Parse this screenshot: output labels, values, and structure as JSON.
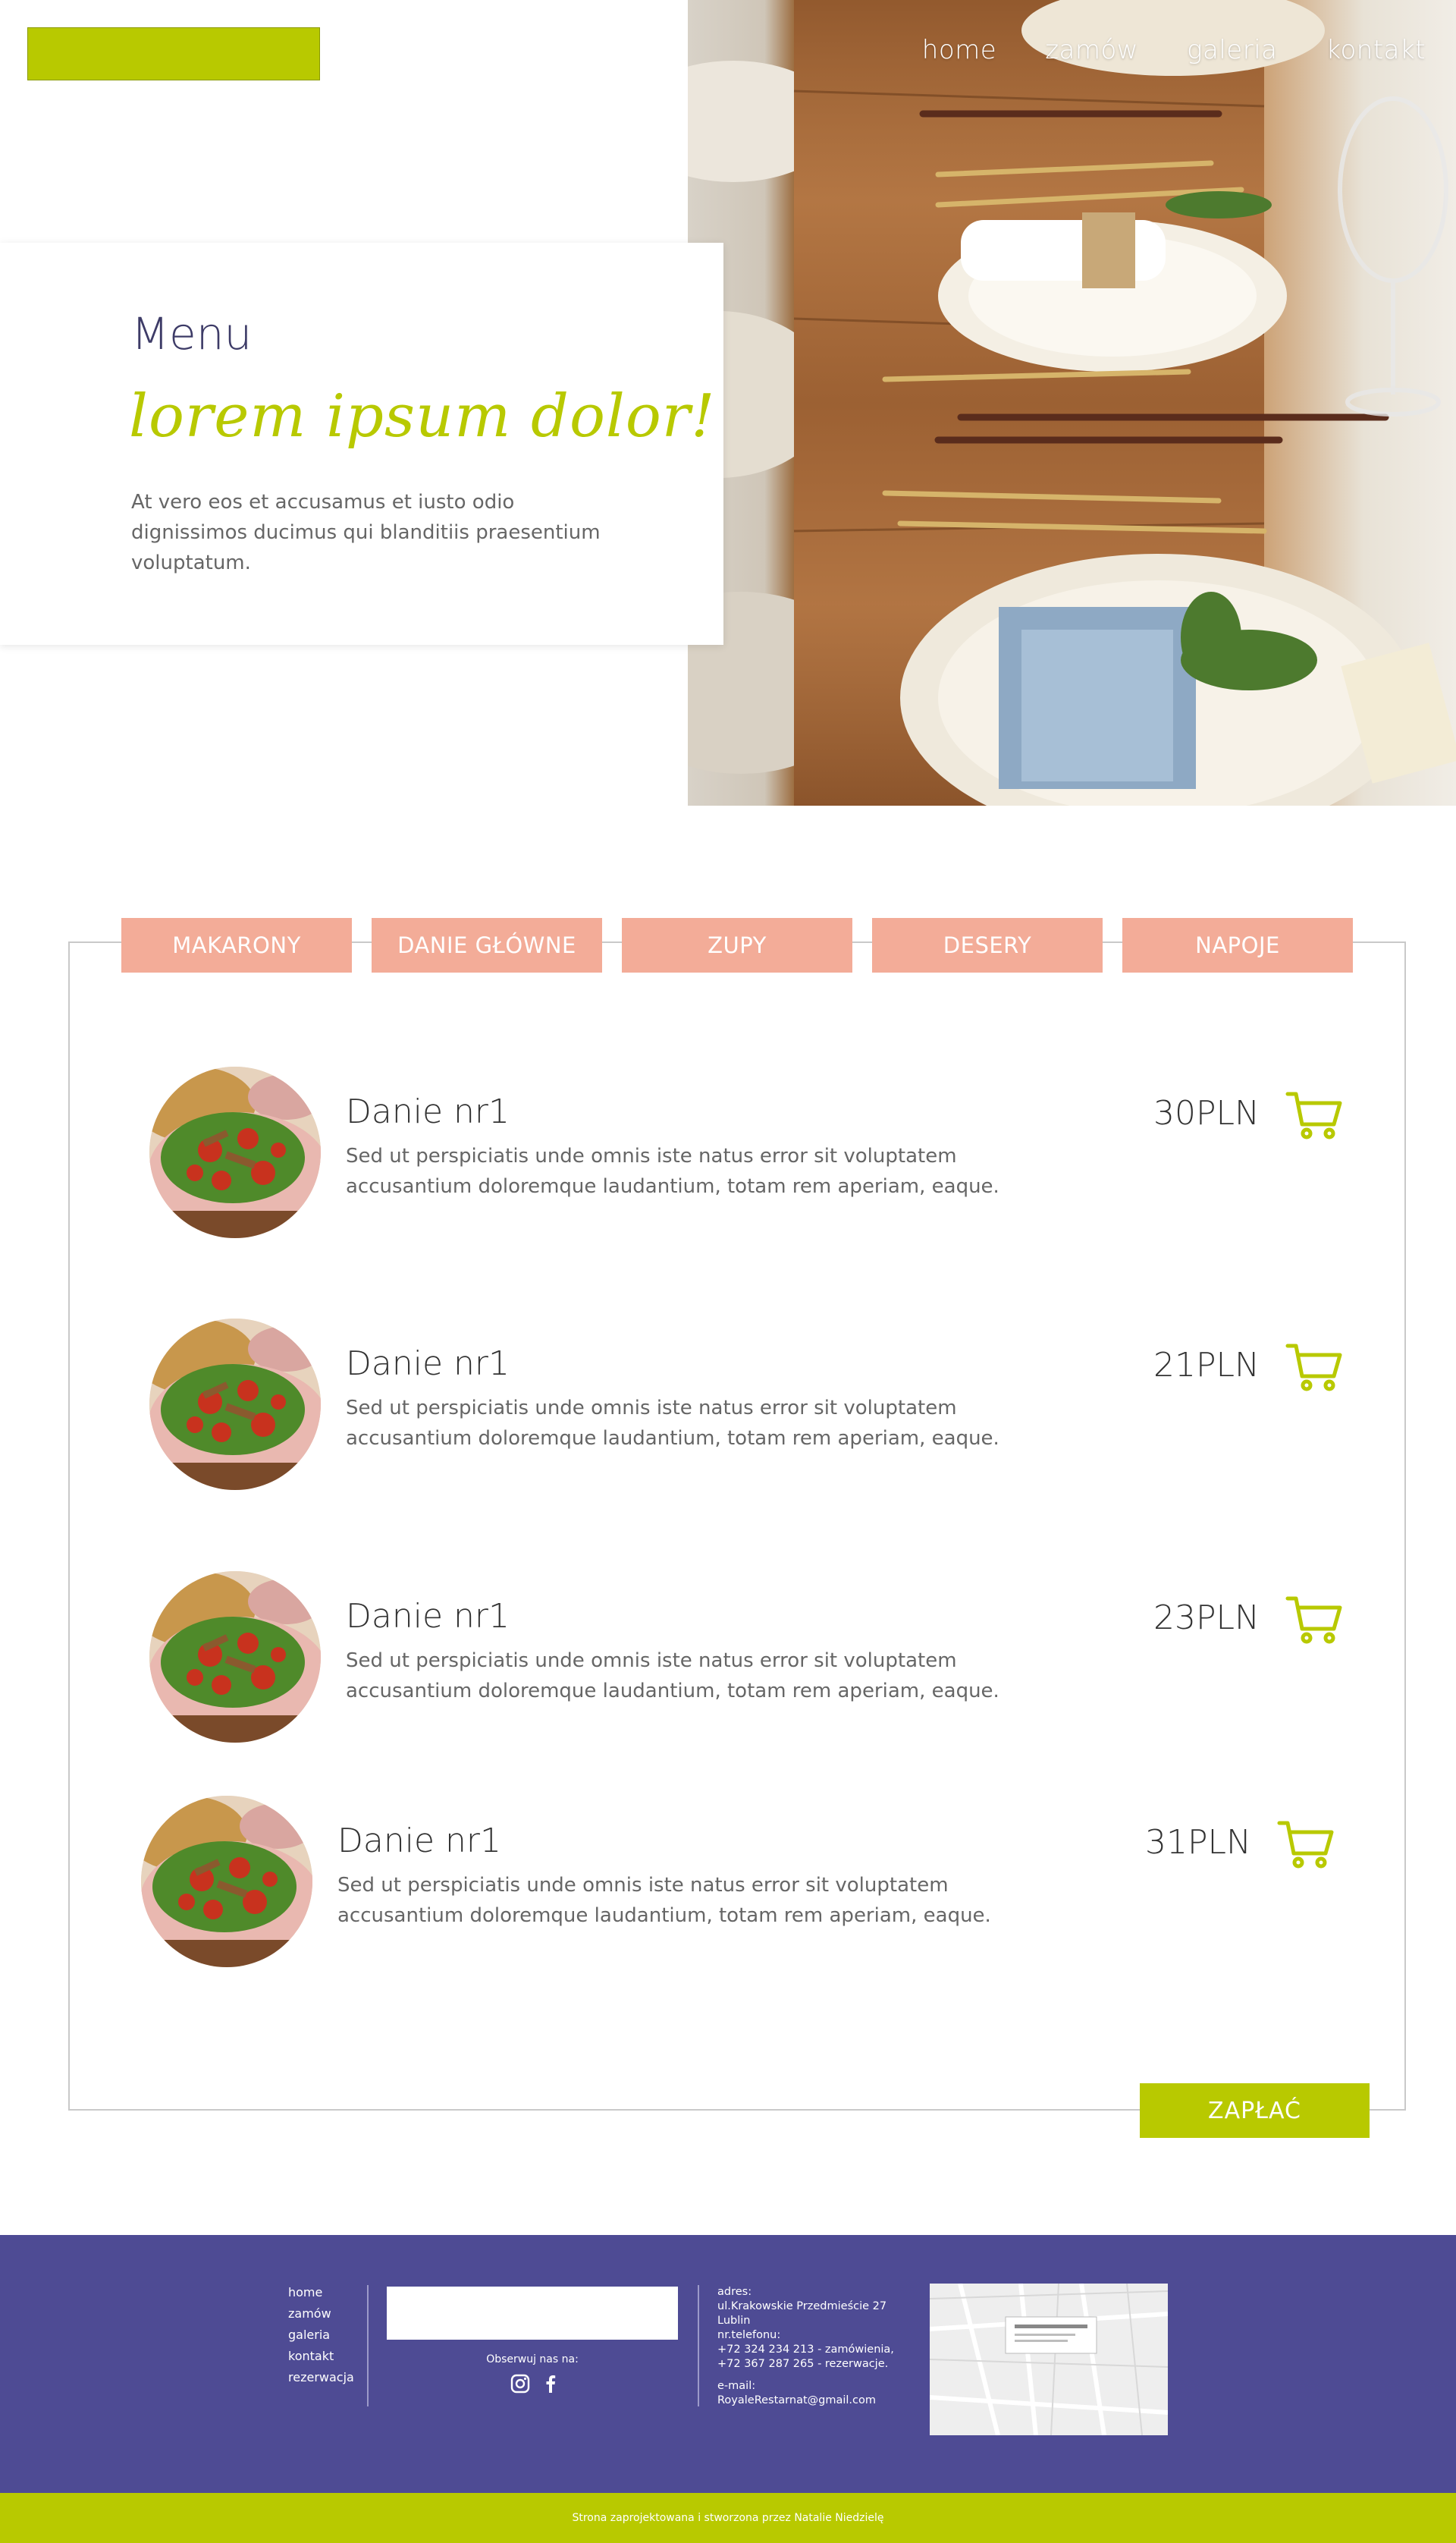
{
  "header": {
    "nav": [
      "home",
      "zamów",
      "galeria",
      "kontakt"
    ]
  },
  "hero": {
    "title": "Menu",
    "script": "lorem ipsum dolor!",
    "text": "At vero eos et accusamus et iusto odio dignissimos ducimus qui blanditiis praesentium voluptatum."
  },
  "menu": {
    "tabs": [
      "MAKARONY",
      "DANIE GŁÓWNE",
      "ZUPY",
      "DESERY",
      "NAPOJE"
    ],
    "dishes": [
      {
        "name": "Danie nr1",
        "desc": "Sed ut perspiciatis unde omnis iste natus error sit voluptatem accusantium doloremque laudantium, totam rem aperiam, eaque.",
        "price": "30PLN"
      },
      {
        "name": "Danie nr1",
        "desc": "Sed ut perspiciatis unde omnis iste natus error sit voluptatem accusantium doloremque laudantium, totam rem aperiam, eaque.",
        "price": "21PLN"
      },
      {
        "name": "Danie nr1",
        "desc": "Sed ut perspiciatis unde omnis iste natus error sit voluptatem accusantium doloremque laudantium, totam rem aperiam, eaque.",
        "price": "23PLN"
      },
      {
        "name": "Danie nr1",
        "desc": "Sed ut perspiciatis unde omnis iste natus error sit voluptatem accusantium doloremque laudantium, totam rem aperiam, eaque.",
        "price": "31PLN"
      }
    ],
    "pay_label": "ZAPŁAĆ"
  },
  "footer": {
    "nav": [
      "home",
      "zamów",
      "galeria",
      "kontakt",
      "rezerwacja"
    ],
    "follow": "Obserwuj nas na:",
    "social_icons": [
      "instagram-icon",
      "facebook-icon"
    ],
    "address_label": "adres:",
    "address_line1": "ul.Krakowskie Przedmieście 27",
    "address_line2": "Lublin",
    "phone_label": "nr.telefonu:",
    "phone_line1": "+72 324 234 213 - zamówienia,",
    "phone_line2": "+72 367 287 265 - rezerwacje.",
    "email_label": "e-mail:",
    "email": "RoyaleRestarnat@gmail.com",
    "copyright": "Strona zaprojektowana i stworzona przez Natalie Niedzielę"
  },
  "colors": {
    "accent": "#b8c900",
    "tab": "#f3ac98",
    "footer": "#4e4b94",
    "title": "#3d3b67"
  }
}
